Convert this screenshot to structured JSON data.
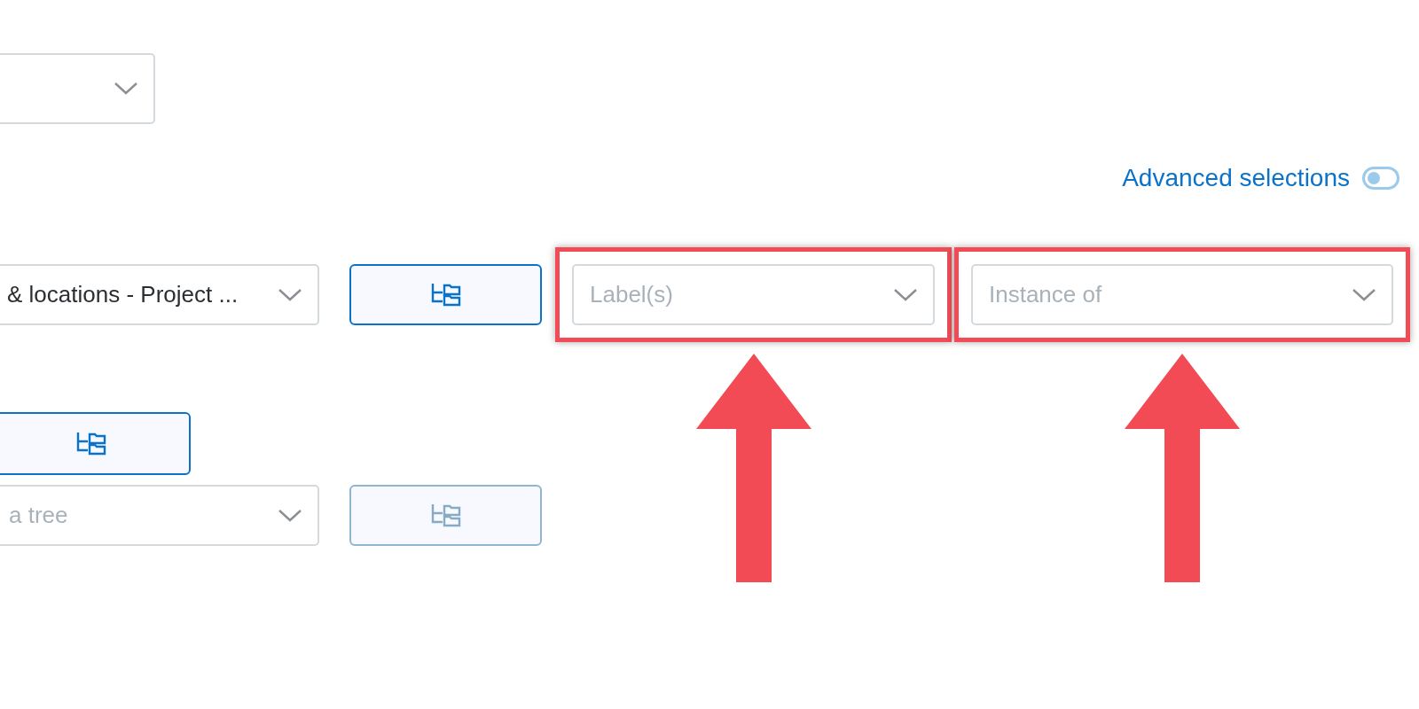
{
  "top_select": {
    "kind": "dropdown"
  },
  "advanced_selections": {
    "label": "Advanced selections",
    "on": false
  },
  "row_1": {
    "select": {
      "value": "& locations - Project ..."
    },
    "tree_button": {
      "disabled": false
    },
    "filters": [
      {
        "placeholder": "Label(s)",
        "highlighted": true
      },
      {
        "placeholder": "Instance of",
        "highlighted": true
      }
    ]
  },
  "row_2": {
    "tree_button": {
      "disabled": false
    }
  },
  "row_3": {
    "select": {
      "placeholder": "a tree"
    },
    "tree_button": {
      "disabled": true
    }
  }
}
